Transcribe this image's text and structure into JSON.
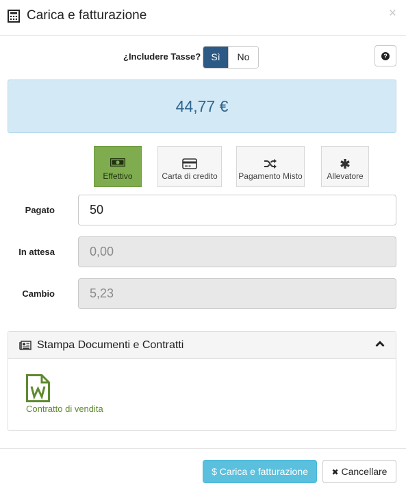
{
  "modal": {
    "title": "Carica e fatturazione",
    "close_glyph": "×",
    "title_icon": "calculator-icon"
  },
  "tax": {
    "label": "¿Includere Tasse?",
    "yes_label": "Sì",
    "no_label": "No",
    "selected": "Sì",
    "help_glyph": "?"
  },
  "total": {
    "amount": "44,77 €"
  },
  "payment_methods": [
    {
      "label": "Effettivo",
      "icon": "cash-icon",
      "active": true
    },
    {
      "label": "Carta di credito",
      "icon": "credit-card-icon",
      "active": false
    },
    {
      "label": "Pagamento Misto",
      "icon": "shuffle-icon",
      "active": false
    },
    {
      "label": "Allevatore",
      "icon": "asterisk-icon",
      "active": false
    }
  ],
  "fields": {
    "paid": {
      "label": "Pagato",
      "value": "50"
    },
    "pending": {
      "label": "In attesa",
      "value": "0,00"
    },
    "change": {
      "label": "Cambio",
      "value": "5,23"
    }
  },
  "documents_panel": {
    "title": "Stampa Documenti e Contratti",
    "items": [
      {
        "label": "Contratto di vendita",
        "icon": "word-document-icon"
      }
    ]
  },
  "footer": {
    "submit_label": "$ Carica e fatturazione",
    "cancel_label": "Cancellare",
    "cancel_glyph": "✖"
  },
  "colors": {
    "primary_dark": "#2c5a85",
    "total_bg": "#d3e9f5",
    "total_text": "#2f6690",
    "active_method": "#7fac4e",
    "submit": "#5bc0de",
    "doc_green": "#5e8a2e"
  }
}
